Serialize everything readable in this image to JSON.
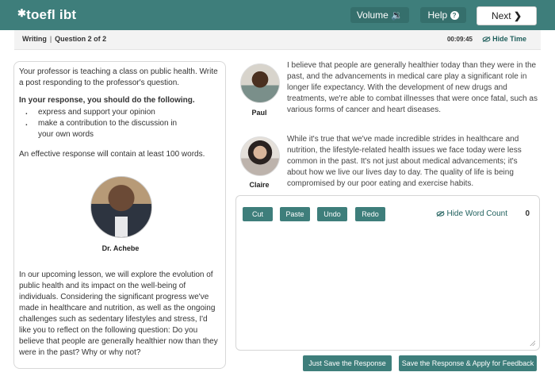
{
  "header": {
    "logo_text": "toefl ibt",
    "volume_label": "Volume",
    "help_label": "Help",
    "next_label": "Next"
  },
  "subheader": {
    "section": "Writing",
    "question": "Question 2 of 2",
    "timer": "00:09:45",
    "hide_time_label": "Hide Time"
  },
  "prompt": {
    "intro": "Your professor is teaching a class on public health. Write a post responding to the professor's question.",
    "instructions_heading": "In your response, you should do the following.",
    "bullets": [
      "express and support your opinion",
      "make a contribution to the discussion in",
      "your own words"
    ],
    "effective": "An effective response will contain at least 100 words.",
    "professor_name": "Dr. Achebe",
    "lesson": "In our upcoming lesson, we will explore the evolution of public health and its impact on the well-being of individuals. Considering the significant progress we've made in healthcare and nutrition, as well as the ongoing challenges such as sedentary lifestyles and stress, I'd like you to reflect on the following question: Do you believe that people are generally healthier now than they were in the past? Why or why not?"
  },
  "responses": [
    {
      "name": "Paul",
      "text": "I believe that people are generally healthier today than they were in the past, and the advancements in medical care play a significant role in longer life expectancy. With the development of new drugs and treatments, we're able to combat illnesses that were once fatal, such as various forms of cancer and heart diseases."
    },
    {
      "name": "Claire",
      "text": "While it's true that we've made incredible strides in healthcare and nutrition, the lifestyle-related health issues we face today were less common in the past. It's not just about medical advancements; it's about how we live our lives day to day. The quality of life is being compromised by our poor eating and exercise habits."
    }
  ],
  "editor": {
    "cut_label": "Cut",
    "paste_label": "Paste",
    "undo_label": "Undo",
    "redo_label": "Redo",
    "hide_word_count_label": "Hide Word Count",
    "word_count": "0",
    "value": ""
  },
  "footer": {
    "save_label": "Just Save the Response",
    "save_feedback_label": "Save the Response & Apply for Feedback"
  },
  "icons": {
    "volume": "speaker-icon",
    "help": "question-circle-icon",
    "next": "chevron-right-icon",
    "hide": "eye-slash-icon"
  },
  "colors": {
    "brand": "#3e7e7b",
    "accent_text": "#1f5f5c"
  }
}
